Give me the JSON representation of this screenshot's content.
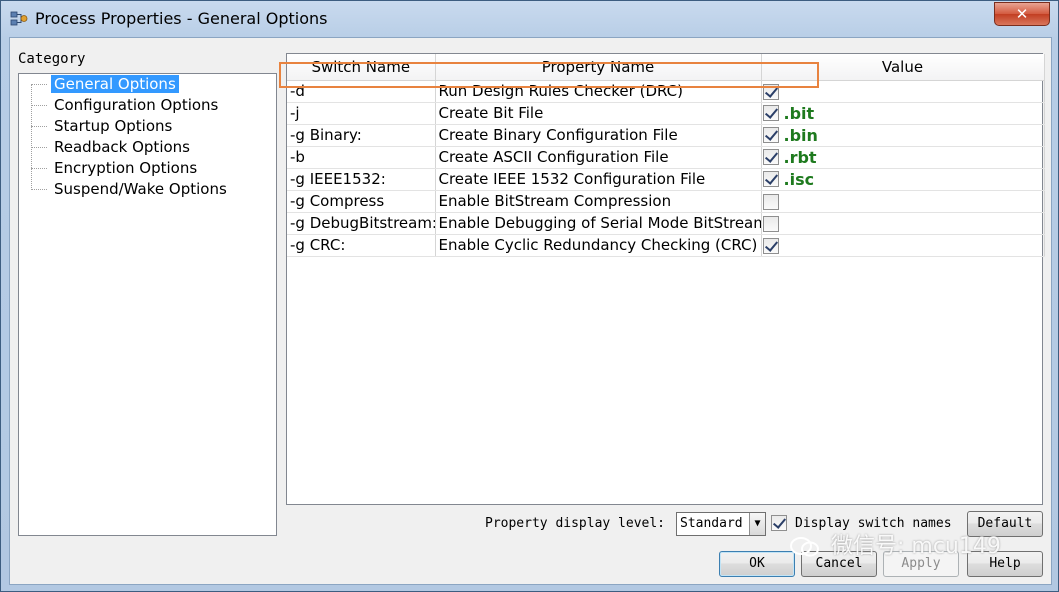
{
  "window": {
    "title": "Process Properties - General Options",
    "close_label": "✕"
  },
  "category": {
    "label": "Category",
    "items": [
      {
        "label": "General Options",
        "selected": true
      },
      {
        "label": "Configuration Options",
        "selected": false
      },
      {
        "label": "Startup Options",
        "selected": false
      },
      {
        "label": "Readback Options",
        "selected": false
      },
      {
        "label": "Encryption Options",
        "selected": false
      },
      {
        "label": "Suspend/Wake Options",
        "selected": false
      }
    ]
  },
  "table": {
    "headers": [
      "Switch Name",
      "Property Name",
      "Value"
    ],
    "rows": [
      {
        "switch": "-d",
        "property": "Run Design Rules Checker (DRC)",
        "checked": true,
        "note": ""
      },
      {
        "switch": "-j",
        "property": "Create Bit File",
        "checked": true,
        "note": ".bit"
      },
      {
        "switch": "-g Binary:",
        "property": "Create Binary Configuration File",
        "checked": true,
        "note": ".bin"
      },
      {
        "switch": "-b",
        "property": "Create ASCII Configuration File",
        "checked": true,
        "note": ".rbt"
      },
      {
        "switch": "-g IEEE1532:",
        "property": "Create IEEE 1532 Configuration File",
        "checked": true,
        "note": ".isc"
      },
      {
        "switch": "-g Compress",
        "property": "Enable BitStream Compression",
        "checked": false,
        "note": ""
      },
      {
        "switch": "-g DebugBitstream:",
        "property": "Enable Debugging of Serial Mode BitStream",
        "checked": false,
        "note": ""
      },
      {
        "switch": "-g CRC:",
        "property": "Enable Cyclic Redundancy Checking (CRC)",
        "checked": true,
        "note": ""
      }
    ]
  },
  "footer": {
    "display_level_label": "Property display level:",
    "display_level_value": "Standard",
    "display_switch_label": "Display switch names",
    "display_switch_checked": true,
    "default_label": "Default",
    "ok_label": "OK",
    "cancel_label": "Cancel",
    "apply_label": "Apply",
    "help_label": "Help"
  },
  "watermark": {
    "text": "微信号: mcu149"
  },
  "colors": {
    "selection": "#3399ff",
    "highlight_box": "#e8833f",
    "note_green": "#1e7a1e"
  }
}
